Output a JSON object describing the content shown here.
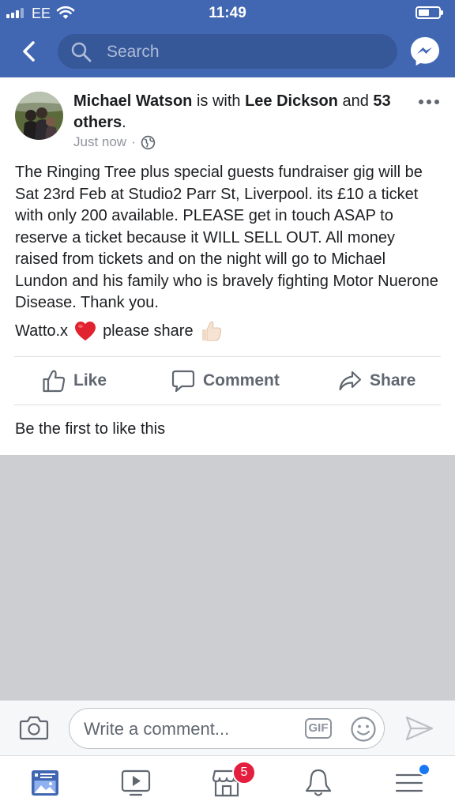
{
  "status_bar": {
    "carrier": "EE",
    "time": "11:49"
  },
  "nav": {
    "search_placeholder": "Search"
  },
  "post": {
    "author": "Michael Watson",
    "with_text": " is with ",
    "tagged": "Lee Dickson",
    "and_text": " and ",
    "others": "53 others",
    "period": ".",
    "timestamp": "Just now",
    "separator": "·",
    "body": "The Ringing Tree plus special guests fundraiser gig will be Sat 23rd Feb at Studio2 Parr St, Liverpool. its £10 a ticket with only 200 available. PLEASE get in touch ASAP to reserve a ticket because it WILL SELL OUT. All money raised from tickets and on the night will go to Michael Lundon and his family who is bravely fighting Motor Nuerone Disease. Thank you.",
    "signoff": "Watto.x",
    "share_text": "please share",
    "actions": {
      "like": "Like",
      "comment": "Comment",
      "share": "Share"
    },
    "reactions_text": "Be the first to like this"
  },
  "comment_bar": {
    "placeholder": "Write a comment...",
    "gif_label": "GIF"
  },
  "tab_bar": {
    "icons": [
      "news-feed-icon",
      "watch-icon",
      "marketplace-icon",
      "notifications-icon",
      "menu-icon"
    ],
    "marketplace_badge": "5"
  },
  "colors": {
    "brand": "#4267b2",
    "search_bg": "#365899",
    "badge": "#e41e3f"
  }
}
